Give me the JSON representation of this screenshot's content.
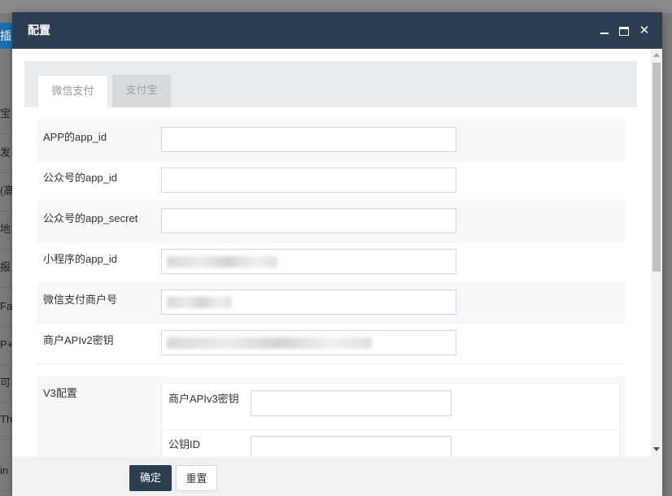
{
  "background": {
    "button_label": "插件",
    "rows": [
      "宝",
      "发",
      "(高",
      "地",
      "报",
      "Fa",
      "P+",
      "可",
      "Thi",
      "in"
    ]
  },
  "dialog": {
    "title": "配置",
    "tabs": [
      {
        "label": "微信支付",
        "active": true
      },
      {
        "label": "支付宝",
        "active": false
      }
    ],
    "fields": [
      {
        "label": "APP的app_id",
        "value": ""
      },
      {
        "label": "公众号的app_id",
        "value": ""
      },
      {
        "label": "公众号的app_secret",
        "value": ""
      },
      {
        "label": "小程序的app_id",
        "value": "[blurred]"
      },
      {
        "label": "微信支付商户号",
        "value": "[blurred]"
      },
      {
        "label": "商户APIv2密钥",
        "value": "[blurred]"
      }
    ],
    "v3": {
      "label": "V3配置",
      "fields": [
        {
          "label": "商户APIv3密钥",
          "value": ""
        },
        {
          "label": "公钥ID",
          "value": ""
        }
      ]
    },
    "buttons": {
      "confirm": "确定",
      "reset": "重置"
    }
  },
  "colors": {
    "titlebar": "#2c3e50",
    "primary_button": "#2c3e50",
    "host_button": "#1e6fb0"
  }
}
